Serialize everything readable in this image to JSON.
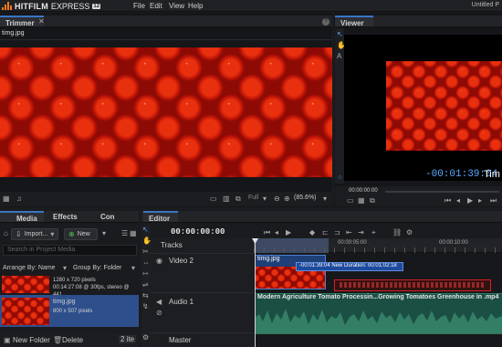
{
  "app": {
    "brand_bold": "HITFILM",
    "brand_light": "EXPRESS",
    "version": "12",
    "project_title": "Untitled P",
    "menu": [
      "File",
      "Edit",
      "View",
      "Help"
    ]
  },
  "trimmer": {
    "tab": "Trimmer",
    "file_name": "timg.jpg",
    "zoom_label": "Full",
    "zoom_value": "(85.6%)"
  },
  "viewer": {
    "tab": "Viewer",
    "timecode_small": "00:00:00:00",
    "timecode": "-00:01:39:04",
    "time_label": "Tim"
  },
  "media": {
    "tabs": [
      "Media",
      "Effects",
      "Con"
    ],
    "import_label": "Import...",
    "new_label": "New",
    "search_placeholder": "Search in Project Media",
    "arrange_label": "Arrange By: Name",
    "group_label": "Group By: Folder",
    "items": [
      {
        "line1": "1280 x 720 pixels",
        "line2": "00:14:27:08 @ 30fps, stereo @ 441"
      },
      {
        "name": "timg.jpg",
        "line1": "800 x 507 pixels"
      }
    ],
    "new_folder_label": "New Folder",
    "delete_label": "Delete",
    "count_label": "2 ite"
  },
  "editor": {
    "tab": "Editor",
    "timecode": "00:00:00:00",
    "tracks_label": "Tracks",
    "ruler_marks": [
      "00:00:05:00",
      "00:00:10:00"
    ],
    "video_track": "Video 2",
    "audio_track": "Audio 1",
    "master_track": "Master",
    "video_clip_name": "timg.jpg",
    "tooltip": "-00:01:39:04 New Duration: 00:01:02:18",
    "audio_clip_name": "Modern Agriculture Tomato Processin...Growing Tomatoes Greenhouse in .mp4"
  }
}
